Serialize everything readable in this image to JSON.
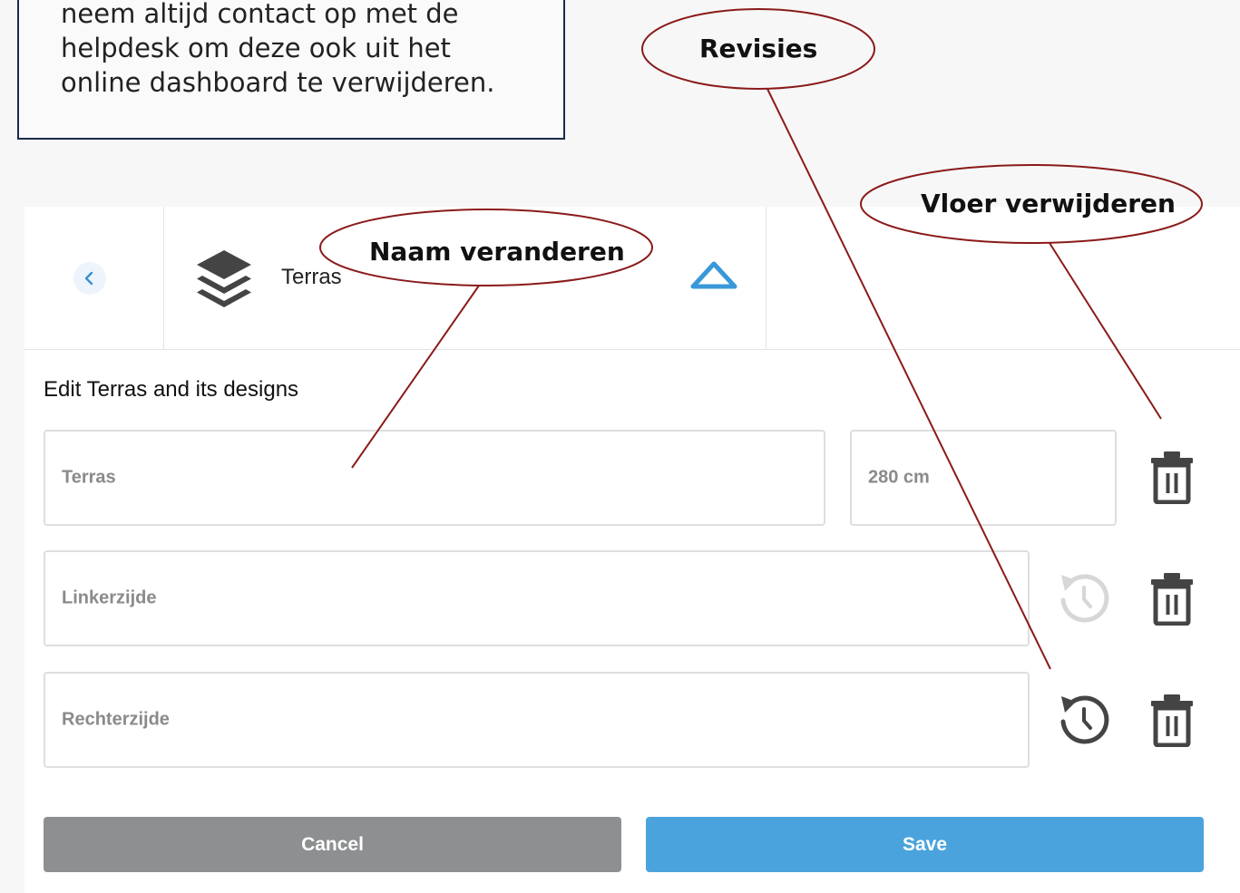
{
  "note": {
    "text": "neem altijd contact op met de\nhelpdesk om deze ook uit het\nonline dashboard te verwijderen."
  },
  "header": {
    "back_icon": "chevron-left-icon",
    "layer_icon": "layers-icon",
    "layer_title": "Terras",
    "collapse_icon": "triangle-up-icon"
  },
  "edit": {
    "heading": "Edit Terras and its designs",
    "name_value": "Terras",
    "height_value": "280 cm",
    "designs": [
      {
        "label": "Linkerzijde",
        "revision_enabled": false
      },
      {
        "label": "Rechterzijde",
        "revision_enabled": true
      }
    ]
  },
  "actions": {
    "cancel_label": "Cancel",
    "save_label": "Save"
  },
  "annotations": {
    "revisies": "Revisies",
    "vloer_verwijderen": "Vloer verwijderen",
    "naam_veranderen": "Naam veranderen"
  },
  "colors": {
    "accent_blue": "#4aa3dc",
    "cancel_gray": "#8e8f90",
    "annotation_red": "#8b1a1a",
    "note_border": "#1c2b4a"
  }
}
